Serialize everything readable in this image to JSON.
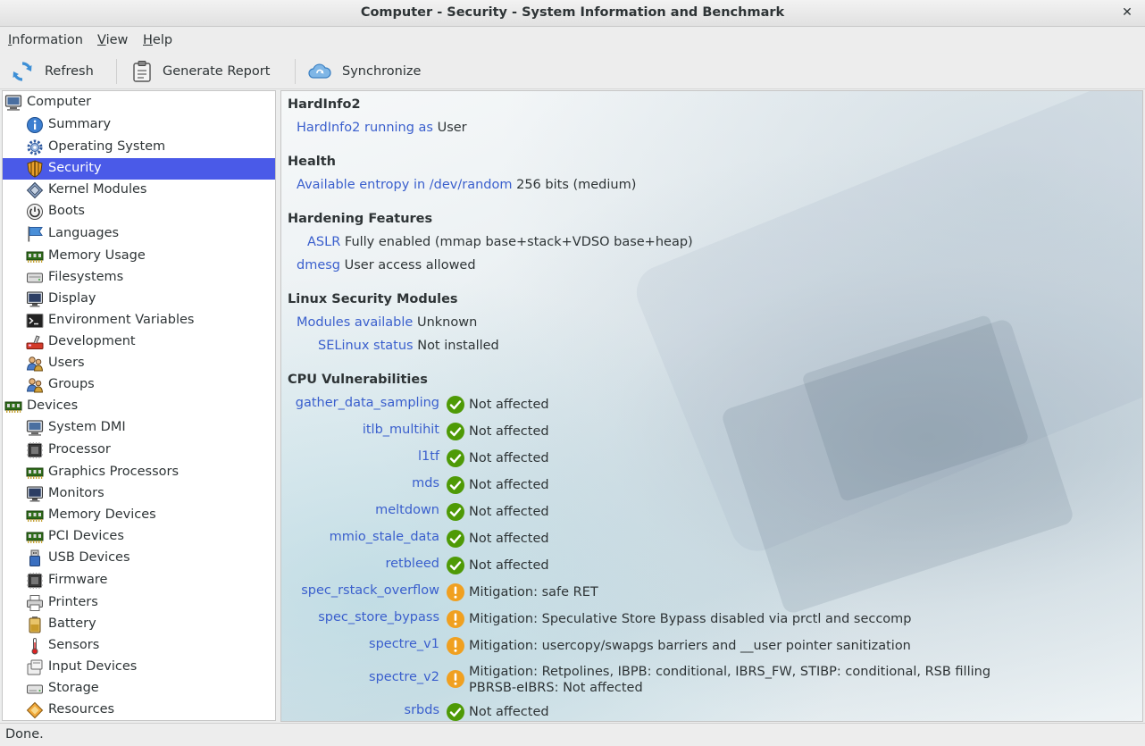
{
  "window": {
    "title": "Computer - Security - System Information and Benchmark",
    "close_glyph": "✕"
  },
  "menu": [
    {
      "mnemonic": "I",
      "rest": "nformation"
    },
    {
      "mnemonic": "V",
      "rest": "iew"
    },
    {
      "mnemonic": "H",
      "rest": "elp"
    }
  ],
  "toolbar": {
    "refresh": "Refresh",
    "generate_report": "Generate Report",
    "synchronize": "Synchronize"
  },
  "sidebar": {
    "groups": [
      {
        "label": "Computer",
        "icon": "computer-icon"
      },
      {
        "label": "Devices",
        "icon": "devices-icon"
      }
    ],
    "items": [
      {
        "label": "Summary",
        "icon": "info-icon"
      },
      {
        "label": "Operating System",
        "icon": "gear-icon"
      },
      {
        "label": "Security",
        "icon": "shield-icon",
        "selected": true
      },
      {
        "label": "Kernel Modules",
        "icon": "module-icon"
      },
      {
        "label": "Boots",
        "icon": "power-icon"
      },
      {
        "label": "Languages",
        "icon": "flag-icon"
      },
      {
        "label": "Memory Usage",
        "icon": "memory-icon"
      },
      {
        "label": "Filesystems",
        "icon": "drive-icon"
      },
      {
        "label": "Display",
        "icon": "monitor-icon"
      },
      {
        "label": "Environment Variables",
        "icon": "terminal-icon"
      },
      {
        "label": "Development",
        "icon": "development-icon"
      },
      {
        "label": "Users",
        "icon": "users-icon"
      },
      {
        "label": "Groups",
        "icon": "groups-icon"
      },
      {
        "label": "System DMI",
        "icon": "computer-icon"
      },
      {
        "label": "Processor",
        "icon": "cpu-icon"
      },
      {
        "label": "Graphics Processors",
        "icon": "gpu-icon"
      },
      {
        "label": "Monitors",
        "icon": "monitor-icon"
      },
      {
        "label": "Memory Devices",
        "icon": "memory-icon"
      },
      {
        "label": "PCI Devices",
        "icon": "pci-icon"
      },
      {
        "label": "USB Devices",
        "icon": "usb-icon"
      },
      {
        "label": "Firmware",
        "icon": "chip-icon"
      },
      {
        "label": "Printers",
        "icon": "printer-icon"
      },
      {
        "label": "Battery",
        "icon": "battery-icon"
      },
      {
        "label": "Sensors",
        "icon": "thermometer-icon"
      },
      {
        "label": "Input Devices",
        "icon": "input-devices-icon"
      },
      {
        "label": "Storage",
        "icon": "storage-icon"
      },
      {
        "label": "Resources",
        "icon": "resources-icon"
      }
    ]
  },
  "content": {
    "hardinfo": {
      "title": "HardInfo2",
      "key": "HardInfo2 running as",
      "value": "User"
    },
    "health": {
      "title": "Health",
      "key": "Available entropy in /dev/random",
      "value": "256 bits (medium)"
    },
    "hardening": {
      "title": "Hardening Features",
      "rows": [
        {
          "key": "ASLR",
          "value": "Fully enabled (mmap base+stack+VDSO base+heap)"
        },
        {
          "key": "dmesg",
          "value": "User access allowed"
        }
      ]
    },
    "lsm": {
      "title": "Linux Security Modules",
      "rows": [
        {
          "key": "Modules available",
          "value": "Unknown"
        },
        {
          "key": "SELinux status",
          "value": "Not installed"
        }
      ]
    },
    "cpu": {
      "title": "CPU Vulnerabilities",
      "rows": [
        {
          "key": "gather_data_sampling",
          "status": "ok",
          "value": "Not affected"
        },
        {
          "key": "itlb_multihit",
          "status": "ok",
          "value": "Not affected"
        },
        {
          "key": "l1tf",
          "status": "ok",
          "value": "Not affected"
        },
        {
          "key": "mds",
          "status": "ok",
          "value": "Not affected"
        },
        {
          "key": "meltdown",
          "status": "ok",
          "value": "Not affected"
        },
        {
          "key": "mmio_stale_data",
          "status": "ok",
          "value": "Not affected"
        },
        {
          "key": "retbleed",
          "status": "ok",
          "value": "Not affected"
        },
        {
          "key": "spec_rstack_overflow",
          "status": "warn",
          "value": "Mitigation: safe RET"
        },
        {
          "key": "spec_store_bypass",
          "status": "warn",
          "value": "Mitigation: Speculative Store Bypass disabled via prctl and seccomp"
        },
        {
          "key": "spectre_v1",
          "status": "warn",
          "value": "Mitigation: usercopy/swapgs barriers and __user pointer sanitization"
        },
        {
          "key": "spectre_v2",
          "status": "warn",
          "value": "Mitigation: Retpolines, IBPB: conditional, IBRS_FW, STIBP: conditional, RSB filling",
          "value_line2": "PBRSB-eIBRS: Not affected"
        },
        {
          "key": "srbds",
          "status": "ok",
          "value": "Not affected"
        }
      ]
    }
  },
  "colors": {
    "selection": "#4a5ae8",
    "link": "#3a5fcd",
    "ok": "#4e9a06",
    "warn": "#f0a020"
  },
  "status_bar": {
    "text": "Done."
  }
}
